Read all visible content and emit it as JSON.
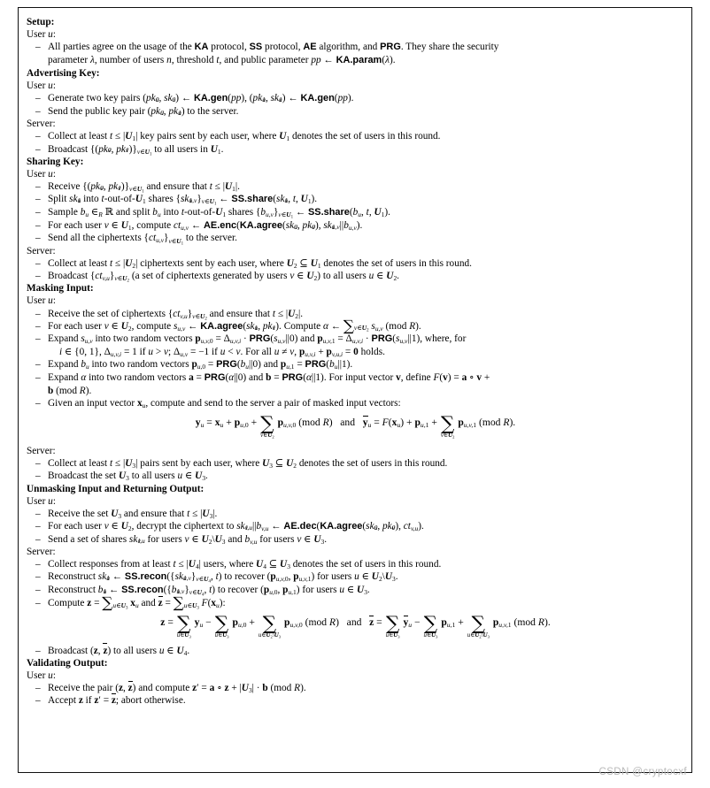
{
  "document": {
    "type": "protocol-specification-figure",
    "watermark": "CSDN @cryptocxf",
    "phases": [
      {
        "title": "Setup:",
        "roles": [
          {
            "label": null,
            "steps": [
              "All parties agree on the usage of the KA protocol, SS protocol, AE algorithm, and PRG. They share the security parameter λ, number of users n, threshold t, and public parameter pp ← KA.param(λ)."
            ]
          }
        ]
      },
      {
        "title": "Advertising Key:",
        "roles": [
          {
            "label": "User u:",
            "steps": [
              "Generate two key pairs (pk_u^0, sk_u^0) ← KA.gen(pp), (pk_u^1, sk_u^1) ← KA.gen(pp).",
              "Send the public key pair (pk_u^0, pk_u^1) to the server."
            ]
          },
          {
            "label": "Server:",
            "steps": [
              "Collect at least t ≤ |U_1| key pairs sent by each user, where U_1 denotes the set of users in this round.",
              "Broadcast {(pk_v^0, pk_v^1)}_{v∈U_1} to all users in U_1."
            ]
          }
        ]
      },
      {
        "title": "Sharing Key:",
        "roles": [
          {
            "label": "User u:",
            "steps": [
              "Receive {(pk_v^0, pk_v^1)}_{v∈U_1} and ensure that t ≤ |U_1|.",
              "Split sk_u^1 into t-out-of-U_1 shares {sk_{u,v}^1}_{v∈U_1} ← SS.share(sk_u^1, t, U_1).",
              "Sample b_u ∈_R R and split b_u into t-out-of-U_1 shares {b_{u,v}}_{v∈U_1} ← SS.share(b_u, t, U_1).",
              "For each user v ∈ U_1, compute ct_{u,v} ← AE.enc(KA.agree(sk_u^0, pk_v^0), sk_{u,v}^1||b_{u,v}).",
              "Send all the ciphertexts {ct_{u,v}}_{v∈U_1} to the server."
            ]
          },
          {
            "label": "Server:",
            "steps": [
              "Collect at least t ≤ |U_2| ciphertexts sent by each user, where U_2 ⊆ U_1 denotes the set of users in this round.",
              "Broadcast {ct_{v,u}}_{v∈U_2} (a set of ciphertexts generated by users v ∈ U_2) to all users u ∈ U_2."
            ]
          }
        ]
      },
      {
        "title": "Masking Input:",
        "roles": [
          {
            "label": "User u:",
            "steps": [
              "Receive the set of ciphertexts {ct_{v,u}}_{v∈U_2} and ensure that t ≤ |U_2|.",
              "For each user v ∈ U_2, compute s_{u,v} ← KA.agree(sk_u^1, pk_v^1). Compute α ← Σ_{v∈U_2} s_{u,v} (mod R).",
              "Expand s_{u,v} into two random vectors p_{u,v,0} = Δ_{u,v,i} · PRG(s_{u,v}||0) and p_{u,v,1} = Δ_{u,v,i} · PRG(s_{u,v}||1), where, for i ∈ {0,1}, Δ_{u,v,i} = 1 if u > v; Δ_{u,v} = −1 if u < v. For all u ≠ v, p_{u,v,i} + p_{v,u,i} = 0 holds.",
              "Expand b_u into two random vectors p_{u,0} = PRG(b_u||0) and p_{u,1} = PRG(b_u||1).",
              "Expand α into two random vectors a = PRG(α||0) and b = PRG(α||1). For input vector v, define F(v) = a ∘ v + b (mod R).",
              "Given an input vector x_u, compute and send to the server a pair of masked input vectors:"
            ]
          }
        ],
        "equation": "y_u = x_u + p_{u,0} + Σ_{v∈U_2} p_{u,v,0} (mod R)   and   ȳ_u = F(x_u) + p_{u,1} + Σ_{v∈U_2} p_{u,v,1} (mod R)."
      },
      {
        "title": null,
        "roles": [
          {
            "label": "Server:",
            "steps": [
              "Collect at least t ≤ |U_3| pairs sent by each user, where U_3 ⊆ U_2 denotes the set of users in this round.",
              "Broadcast the set U_3 to all users u ∈ U_3."
            ]
          }
        ]
      },
      {
        "title": "Unmasking Input and Returning Output:",
        "roles": [
          {
            "label": "User u:",
            "steps": [
              "Receive the set U_3 and ensure that t ≤ |U_3|.",
              "For each user v ∈ U_2, decrypt the ciphertext to sk_{v,u}^1||b_{v,u} ← AE.dec(KA.agree(sk_u^0, pk_v^0), ct_{v,u}).",
              "Send a set of shares sk_{v,u}^1 for users v ∈ U_2\\U_3 and b_{v,u} for users v ∈ U_3."
            ]
          },
          {
            "label": "Server:",
            "steps": [
              "Collect responses from at least t ≤ |U_4| users, where U_4 ⊆ U_3 denotes the set of users in this round.",
              "Reconstruct sk_u^1 ← SS.recon({sk_{u,v}^1}_{v∈U_4}, t) to recover (p_{u,v,0}, p_{u,v,1}) for users u ∈ U_2\\U_3.",
              "Reconstruct b_u^1 ← SS.recon({b_{u,v}^1}_{v∈U_4}, t) to recover (p_{u,0}, p_{u,1}) for users u ∈ U_3.",
              "Compute z = Σ_{u∈U_3} x_u and z̄ = Σ_{u∈U_3} F(x_u):"
            ]
          }
        ],
        "equation": "z = Σ_{u∈U_3} y_u − Σ_{u∈U_3} p_{u,0} + Σ_{u∈U_2\\U_3} p_{u,v,0} (mod R)   and   z̄ = Σ_{u∈U_3} ȳ_u − Σ_{u∈U_3} p_{u,1} + Σ_{u∈U_2\\U_3} p_{u,v,1} (mod R).",
        "post_steps": [
          "Broadcast (z, z̄) to all users u ∈ U_4."
        ]
      },
      {
        "title": "Validating Output:",
        "roles": [
          {
            "label": "User u:",
            "steps": [
              "Receive the pair (z, z̄) and compute z' = a ∘ z + |U_3| · b (mod R).",
              "Accept z if z' = z̄; abort otherwise."
            ]
          }
        ]
      }
    ],
    "labels": {
      "setup": "Setup:",
      "advertising_key": "Advertising Key:",
      "sharing_key": "Sharing Key:",
      "masking_input": "Masking Input:",
      "unmasking": "Unmasking Input and Returning Output:",
      "validating": "Validating Output:",
      "user_u": "User",
      "server": "Server:"
    }
  }
}
